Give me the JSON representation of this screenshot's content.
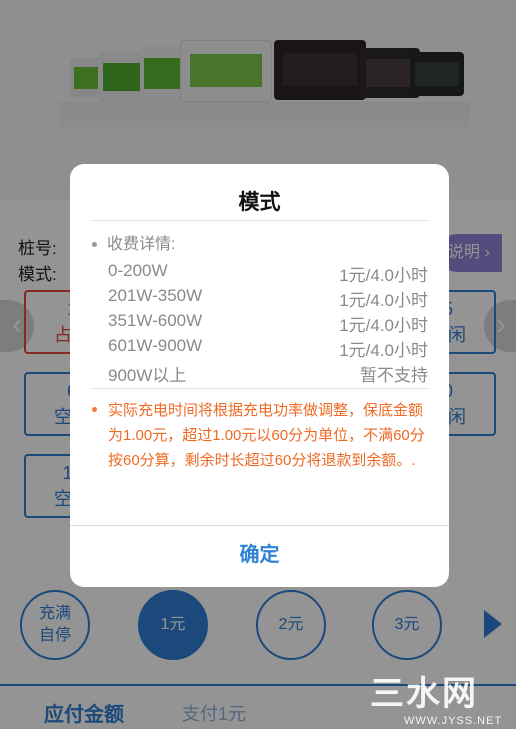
{
  "background": {
    "pile_label": "桩号:",
    "mode_label": "模式:",
    "explain_button": "说明 ›",
    "nav_left": "‹",
    "nav_right": "›",
    "slots": [
      {
        "line1": "1",
        "line2": "占用",
        "status": "occupied"
      },
      {
        "line1": "5",
        "line2": "空闲",
        "status": "idle"
      },
      {
        "line1": "6",
        "line2": "空闲",
        "status": "idle"
      },
      {
        "line1": "0",
        "line2": "空闲",
        "status": "idle"
      },
      {
        "line1": "11",
        "line2": "空闲",
        "status": "idle"
      }
    ],
    "amount_options": [
      {
        "line1": "充满",
        "line2": "自停",
        "active": false
      },
      {
        "label": "1元",
        "active": true
      },
      {
        "label": "2元",
        "active": false
      },
      {
        "label": "3元",
        "active": false
      }
    ],
    "pay_label": "应付金额",
    "pay_value": "支付1元",
    "accent_color": "#2f7fd4",
    "occupied_color": "#e24a3b"
  },
  "watermark": {
    "main": "三水网",
    "sub": "WWW.JYSS.NET"
  },
  "modal": {
    "title": "模式",
    "fee_header": "收费详情:",
    "fee_rows": [
      {
        "range": "0-200W",
        "price": "1元/4.0小时"
      },
      {
        "range": "201W-350W",
        "price": "1元/4.0小时"
      },
      {
        "range": "351W-600W",
        "price": "1元/4.0小时"
      },
      {
        "range": "601W-900W",
        "price": "1元/4.0小时"
      },
      {
        "range": "900W以上",
        "price": "暂不支持"
      }
    ],
    "note": "实际充电时间将根据充电功率做调整，保底金额为1.00元，超过1.00元以60分为单位，不满60分按60分算，剩余时长超过60分将退款到余额。.",
    "confirm": "确定",
    "note_color": "#ef6a25",
    "confirm_color": "#2e83d6"
  }
}
